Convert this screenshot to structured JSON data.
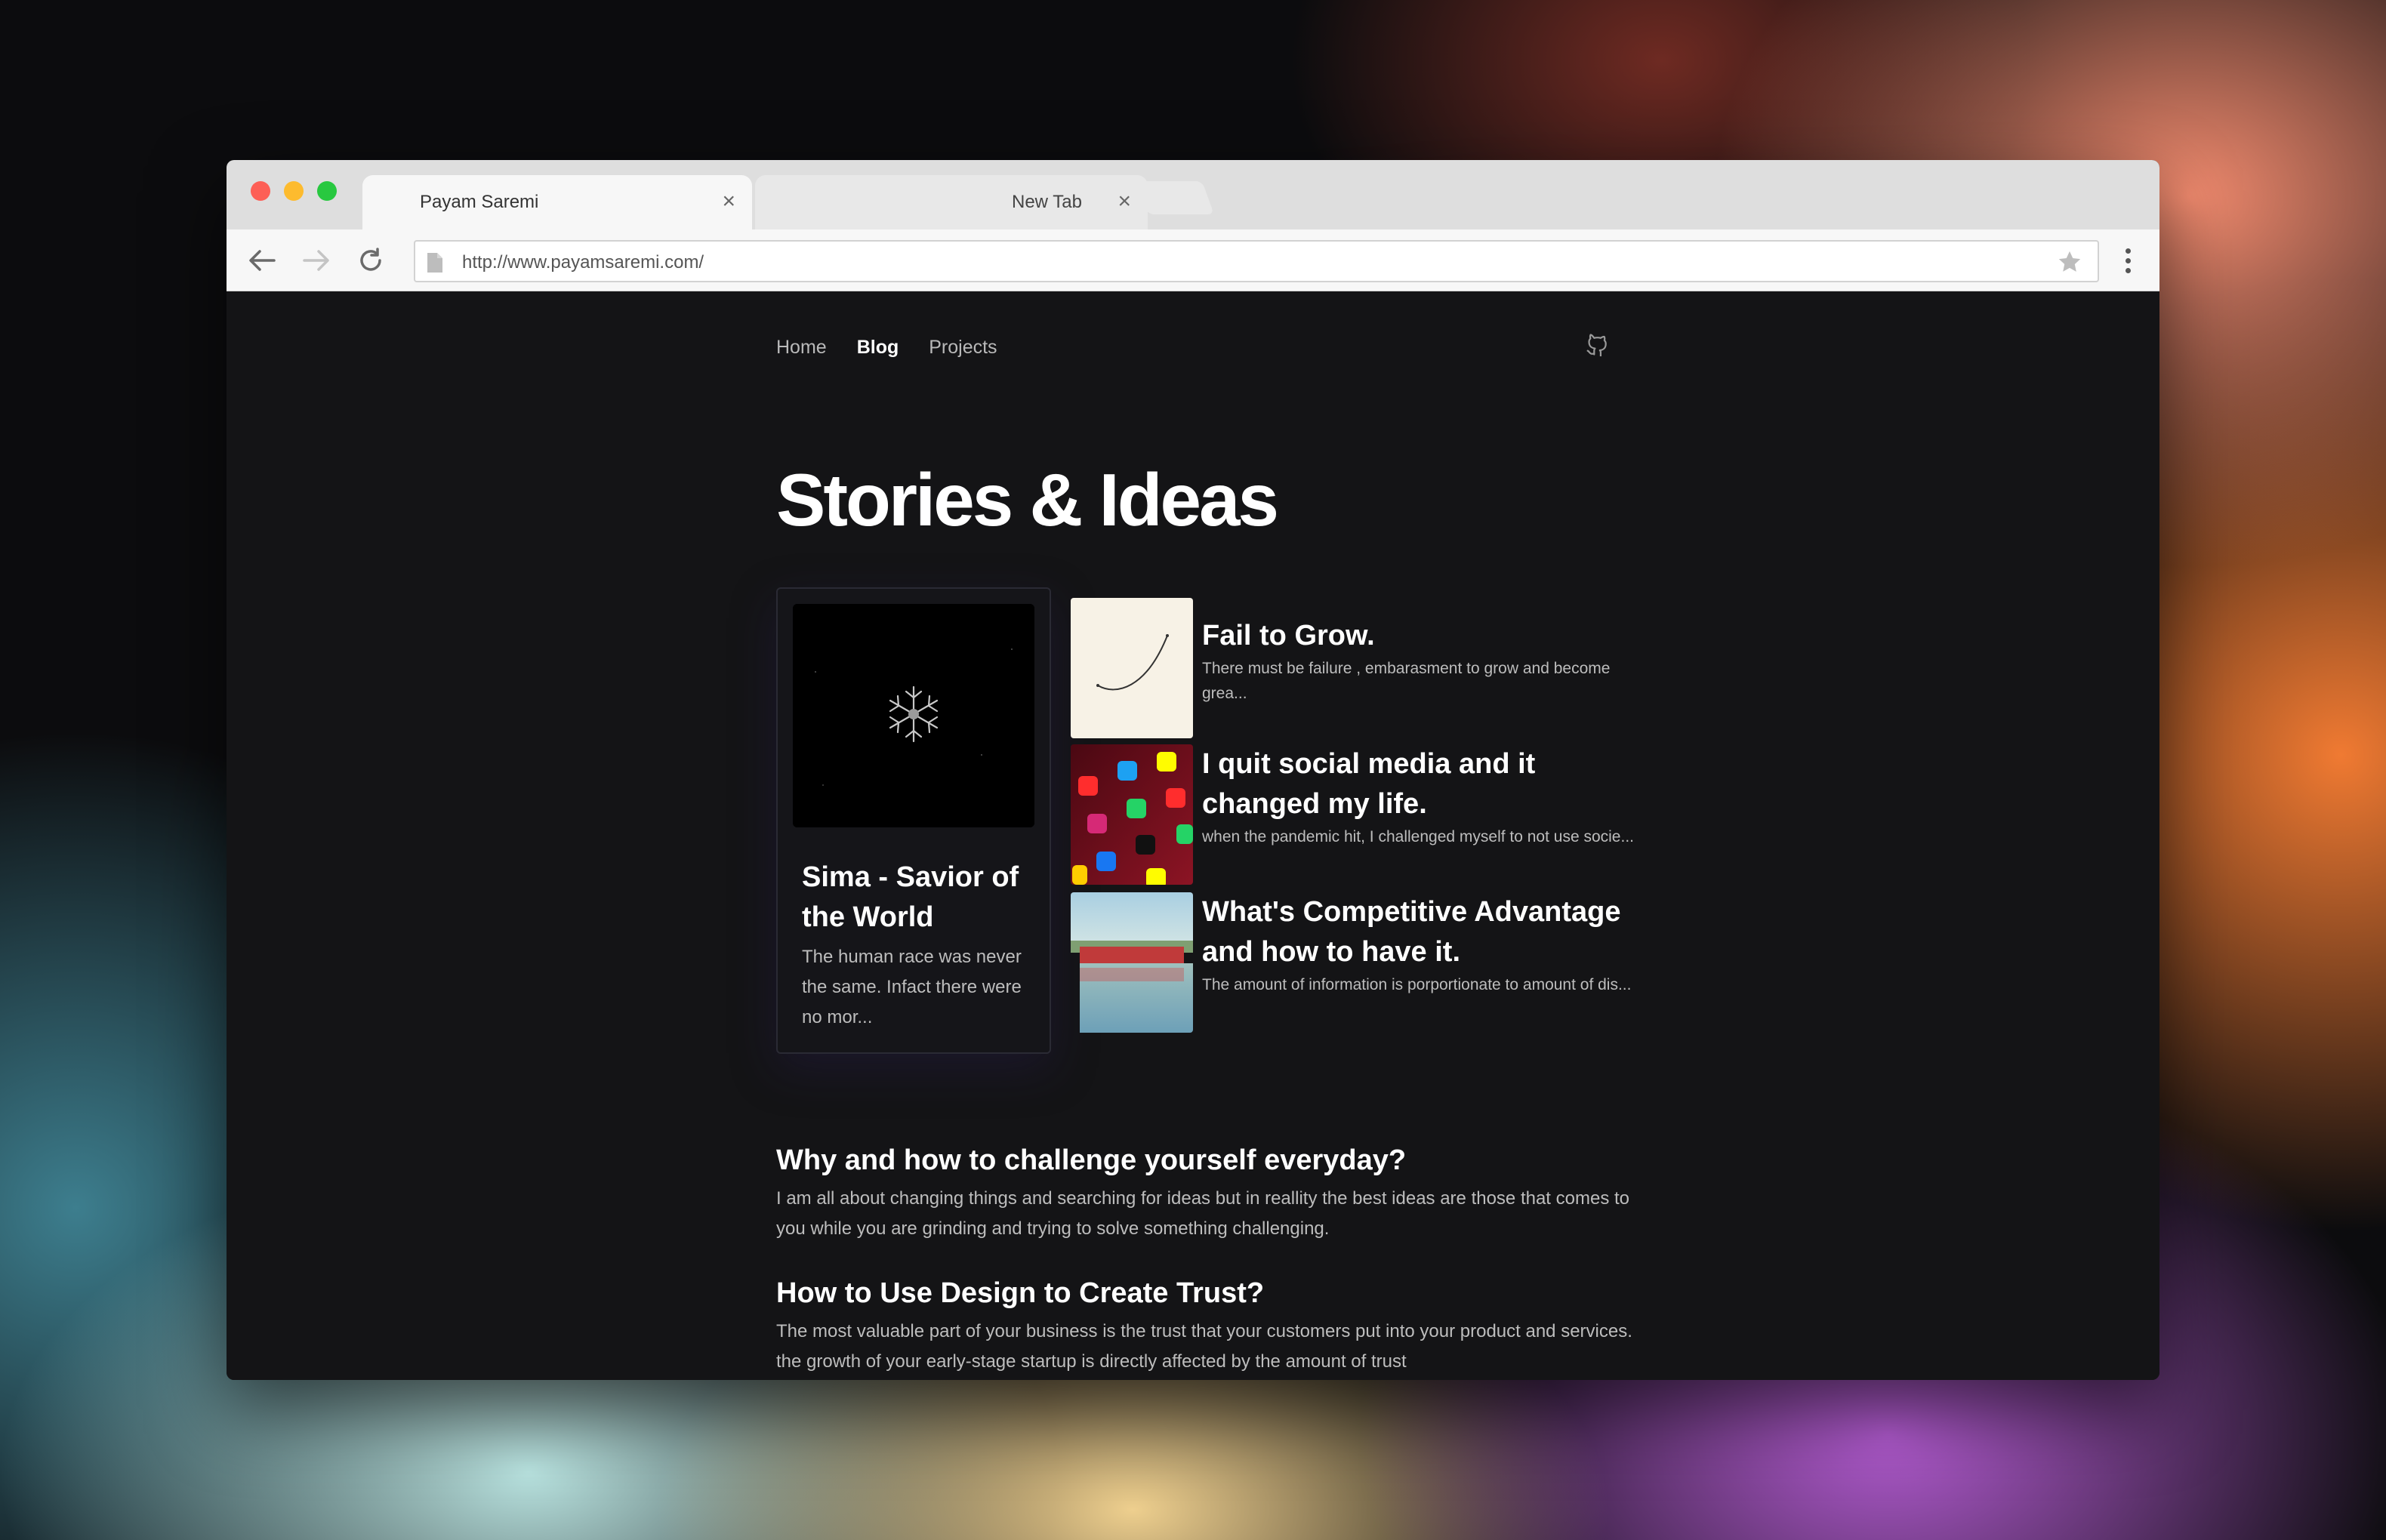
{
  "browser": {
    "tabs": [
      {
        "title": "Payam Saremi",
        "active": true
      },
      {
        "title": "New Tab",
        "active": false
      }
    ],
    "url": "http://www.payamsaremi.com/"
  },
  "site": {
    "nav": [
      "Home",
      "Blog",
      "Projects"
    ],
    "active_nav": "Blog",
    "github_icon": "github-icon",
    "title": "Stories & Ideas"
  },
  "featured": {
    "title": "Sima - Savior of the World",
    "excerpt": "The human race was never the same. Infact there were no mor..."
  },
  "posts": [
    {
      "title": "Fail to Grow.",
      "excerpt": "There must be failure , embarasment to grow and become grea..."
    },
    {
      "title": "I quit social media and it changed my life.",
      "excerpt": "when the pandemic hit, I challenged myself to not use socie..."
    },
    {
      "title": "What's Competitive Advantage and how to have it.",
      "excerpt": "The amount of information is porportionate to amount of dis..."
    }
  ],
  "articles": [
    {
      "title": "Why and how to challenge yourself everyday?",
      "excerpt": "I am all about changing things and searching for ideas but in reallity the best ideas are those that comes to you while you are grinding and trying to solve something challenging."
    },
    {
      "title": "How to Use Design to Create Trust?",
      "excerpt": "The most valuable part of your business is the trust that your customers put into your product and services. the growth of your early-stage startup is directly affected by the amount of trust"
    }
  ],
  "colors": {
    "background": "#141416",
    "text": "#ffffff",
    "muted": "#bdbdbd",
    "card_border": "#2a2a34"
  }
}
